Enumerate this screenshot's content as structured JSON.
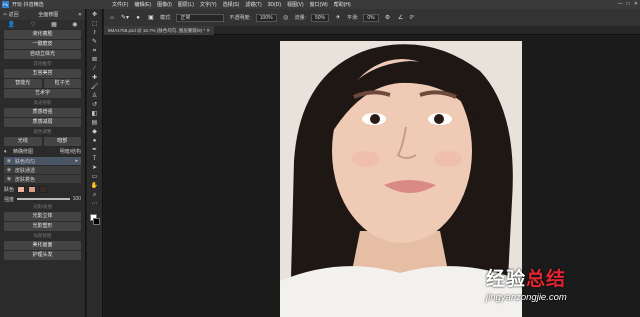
{
  "app": {
    "name": "开玩·抖音精选",
    "badge": "Ps"
  },
  "menu": [
    "文件(F)",
    "编辑(E)",
    "图像(I)",
    "图层(L)",
    "文字(Y)",
    "选择(S)",
    "滤镜(T)",
    "3D(D)",
    "视图(V)",
    "窗口(W)",
    "帮助(H)"
  ],
  "window_buttons": [
    "—",
    "□",
    "✕"
  ],
  "left_panel": {
    "header": {
      "back_icon": "arrow-left-icon",
      "back": "返回",
      "title": "全面修图",
      "close": "✕"
    },
    "buttons1": [
      "液化瘦脸",
      "一键磨皮",
      "自动立体光"
    ],
    "section1": "其他推荐",
    "button_center": "五官美容",
    "pair1": [
      "智能光",
      "粒子光"
    ],
    "button_art": "艺术字",
    "section2": "高光阴影",
    "buttons2": [
      "质感增强",
      "质感减弱"
    ],
    "section3": "颜色调整",
    "pair2": [
      "光线",
      "暗部"
    ],
    "layers_row": {
      "label": "精确修图",
      "right": "明暗/结构"
    },
    "layers": [
      {
        "name": "肤色均匀",
        "selected": true
      },
      {
        "name": "皮肤通透",
        "selected": false
      },
      {
        "name": "皮肤着色",
        "selected": false
      }
    ],
    "swatch_label": "肤色",
    "swatch_colors": [
      "#e7b39e",
      "#d6a08b",
      "#3a2a26"
    ],
    "slider": {
      "label": "强度",
      "value": "100",
      "fraction": 1.0
    },
    "section4": "光影/质感",
    "buttons3": [
      "光影立体",
      "光影塑形"
    ],
    "section5": "局部修图",
    "buttons4": [
      "美化画面",
      "护理头发"
    ]
  },
  "tools": [
    {
      "name": "move-tool-icon",
      "glyph": "✥"
    },
    {
      "name": "marquee-tool-icon",
      "glyph": "⬚"
    },
    {
      "name": "lasso-tool-icon",
      "glyph": "ℓ"
    },
    {
      "name": "quick-select-icon",
      "glyph": "✎"
    },
    {
      "name": "crop-tool-icon",
      "glyph": "⌗"
    },
    {
      "name": "frame-tool-icon",
      "glyph": "⊠"
    },
    {
      "name": "eyedropper-icon",
      "glyph": "⁄"
    },
    {
      "name": "healing-brush-icon",
      "glyph": "✚"
    },
    {
      "name": "brush-tool-icon",
      "glyph": "🖌"
    },
    {
      "name": "clone-stamp-icon",
      "glyph": "♙"
    },
    {
      "name": "history-brush-icon",
      "glyph": "↺"
    },
    {
      "name": "eraser-icon",
      "glyph": "◧"
    },
    {
      "name": "gradient-tool-icon",
      "glyph": "▤"
    },
    {
      "name": "blur-tool-icon",
      "glyph": "◆"
    },
    {
      "name": "dodge-tool-icon",
      "glyph": "●"
    },
    {
      "name": "pen-tool-icon",
      "glyph": "✒"
    },
    {
      "name": "type-tool-icon",
      "glyph": "T"
    },
    {
      "name": "path-select-icon",
      "glyph": "➤"
    },
    {
      "name": "shape-tool-icon",
      "glyph": "▭"
    },
    {
      "name": "hand-tool-icon",
      "glyph": "✋"
    },
    {
      "name": "zoom-tool-icon",
      "glyph": "⌕"
    },
    {
      "name": "more-tools-icon",
      "glyph": "⋯"
    }
  ],
  "options_bar": {
    "mode_label": "模式:",
    "mode_value": "正常",
    "opacity_label": "不透明度:",
    "opacity_value": "100%",
    "flow_label": "流量:",
    "flow_value": "50%",
    "smooth_label": "平滑:",
    "smooth_value": "0%",
    "angle_value": "0°"
  },
  "document_tab": "8MA1768.psd @ 16.7% (肤色均匀, 图层蒙版/8) *  ✕",
  "watermark": {
    "cn_black": "经验",
    "cn_red": "总结",
    "url": "jingyanzongjie.com"
  }
}
